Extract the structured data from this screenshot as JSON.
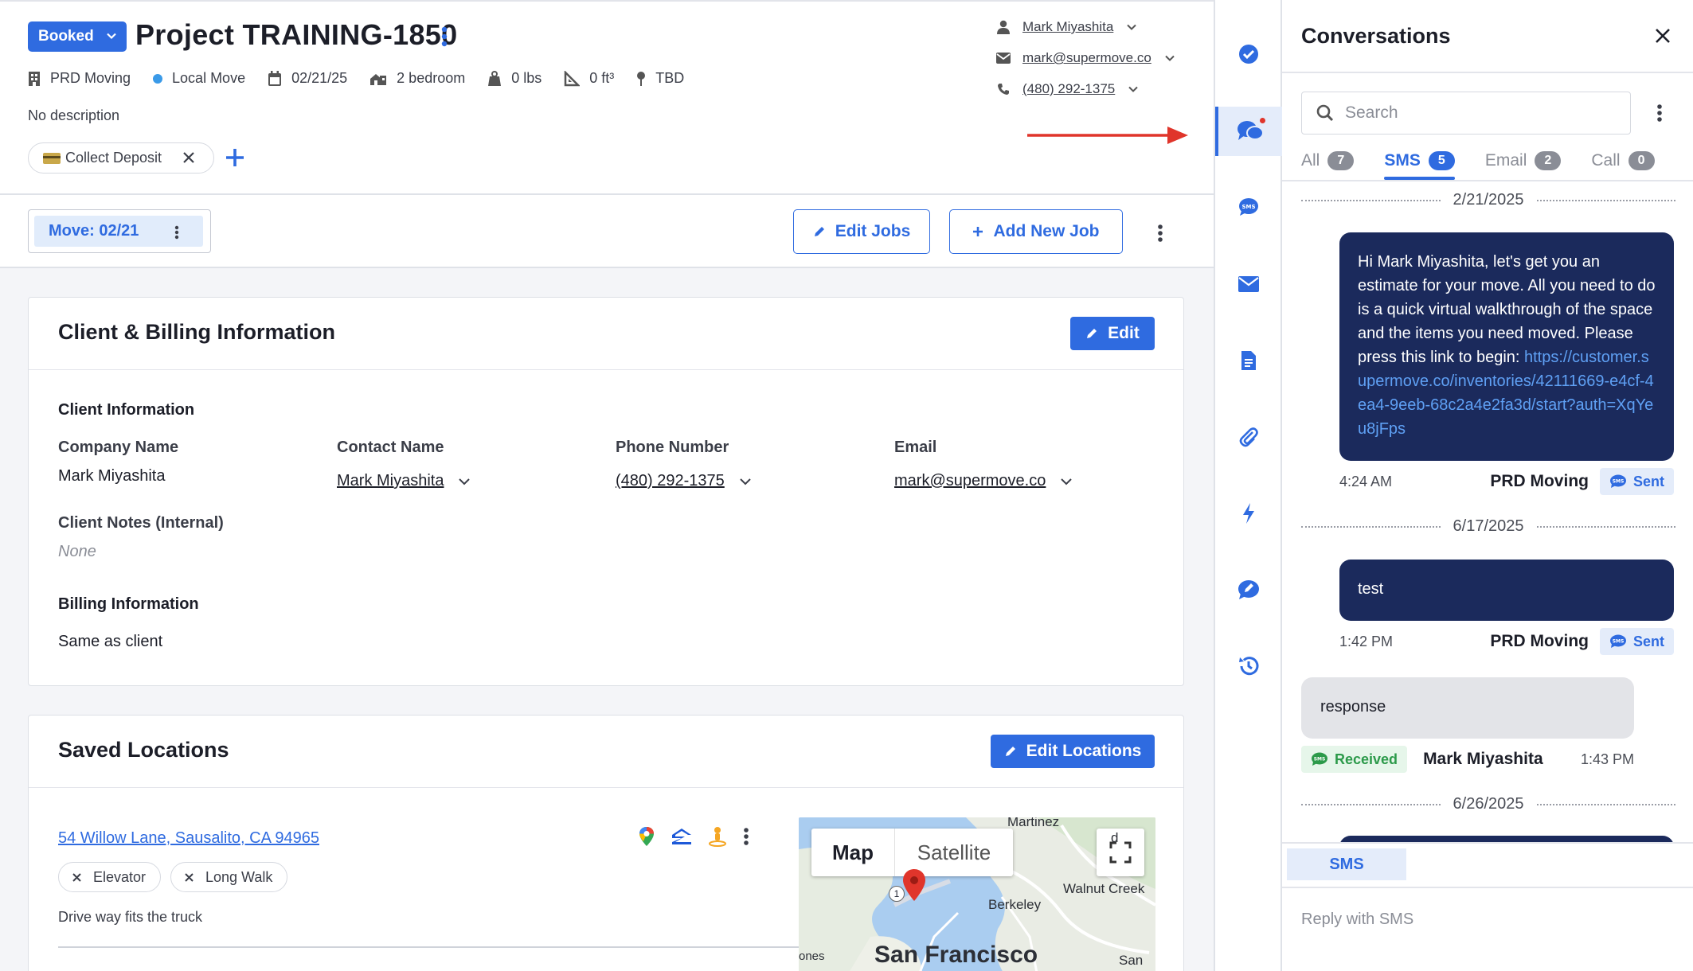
{
  "header": {
    "status": "Booked",
    "project_title": "Project TRAINING-1850",
    "meta": {
      "company": "PRD Moving",
      "move_type": "Local Move",
      "date": "02/21/25",
      "size": "2 bedroom",
      "weight": "0 lbs",
      "volume": "0 ft³",
      "location": "TBD"
    },
    "description": "No description",
    "tag": "Collect Deposit",
    "contact": {
      "name": "Mark Miyashita",
      "email": "mark@supermove.co",
      "phone": "(480) 292-1375"
    }
  },
  "jobs_bar": {
    "move_tab": "Move: 02/21",
    "edit_jobs": "Edit Jobs",
    "add_job": "Add New Job"
  },
  "client_billing": {
    "title": "Client & Billing Information",
    "edit": "Edit",
    "client_info_label": "Client Information",
    "company_name_label": "Company Name",
    "company_name": "Mark Miyashita",
    "contact_name_label": "Contact Name",
    "contact_name": "Mark Miyashita",
    "phone_label": "Phone Number",
    "phone": "(480) 292-1375",
    "email_label": "Email",
    "email": "mark@supermove.co",
    "notes_label": "Client Notes (Internal)",
    "notes": "None",
    "billing_label": "Billing Information",
    "billing": "Same as client"
  },
  "locations": {
    "title": "Saved Locations",
    "edit": "Edit Locations",
    "address": "54 Willow Lane, Sausalito, CA 94965",
    "chips": [
      "Elevator",
      "Long Walk"
    ],
    "note": "Drive way fits the truck",
    "map": {
      "map_tab": "Map",
      "satellite_tab": "Satellite",
      "labels": [
        "Martinez",
        "Walnut Creek",
        "Berkeley",
        "San Francisco",
        "San R",
        "ones",
        "d"
      ],
      "road_shield": "1"
    }
  },
  "conversations": {
    "title": "Conversations",
    "search_placeholder": "Search",
    "tabs": [
      {
        "label": "All",
        "count": "7"
      },
      {
        "label": "SMS",
        "count": "5"
      },
      {
        "label": "Email",
        "count": "2"
      },
      {
        "label": "Call",
        "count": "0"
      }
    ],
    "messages": {
      "date1": "2/21/2025",
      "m1_text": "Hi Mark Miyashita, let's get you an estimate for your move. All you need to do is a quick virtual walkthrough of the space and the items you need moved. Please press this link to begin: ",
      "m1_link": "https://customer.supermove.co/inventories/42111669-e4cf-4ea4-9eeb-68c2a4e2fa3d/start?auth=XqYeu8jFps",
      "m1_time": "4:24 AM",
      "m1_sender": "PRD Moving",
      "m1_status": "Sent",
      "date2": "6/17/2025",
      "m2_text": "test",
      "m2_time": "1:42 PM",
      "m2_sender": "PRD Moving",
      "m2_status": "Sent",
      "m3_text": "response",
      "m3_status": "Received",
      "m3_sender": "Mark Miyashita",
      "m3_time": "1:43 PM",
      "date3": "6/26/2025"
    },
    "compose_tab": "SMS",
    "compose_placeholder": "Reply with SMS"
  },
  "colors": {
    "accent": "#2f6be0",
    "bubble_out": "#1b2a5c",
    "bubble_in": "#e3e4e8",
    "received": "#2c9a4a",
    "notification": "#e0352b",
    "arrow": "#e0352b"
  },
  "icons": {
    "rail": [
      "check-circle-icon",
      "chat-icon",
      "sms-icon",
      "email-icon",
      "document-icon",
      "paperclip-icon",
      "lightning-icon",
      "comment-edit-icon",
      "history-icon"
    ]
  }
}
